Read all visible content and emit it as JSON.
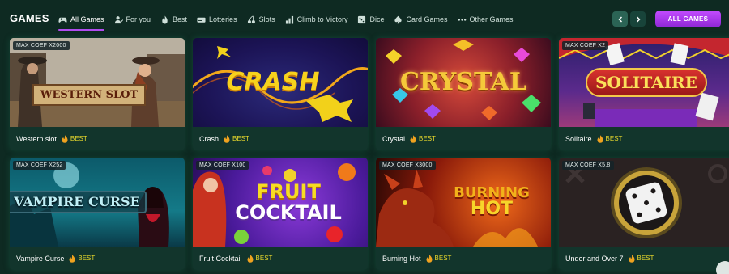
{
  "header": {
    "title": "GAMES",
    "all_games_label": "ALL GAMES",
    "prev_icon": "chevron-left-icon",
    "next_icon": "chevron-right-icon"
  },
  "tabs": [
    {
      "label": "All Games",
      "icon": "gamepad-icon",
      "active": true
    },
    {
      "label": "For you",
      "icon": "person-icon",
      "active": false
    },
    {
      "label": "Best",
      "icon": "flame-icon",
      "active": false
    },
    {
      "label": "Lotteries",
      "icon": "ticket-icon",
      "active": false
    },
    {
      "label": "Slots",
      "icon": "cherries-icon",
      "active": false
    },
    {
      "label": "Climb to Victory",
      "icon": "bar-chart-icon",
      "active": false
    },
    {
      "label": "Dice",
      "icon": "dice-icon",
      "active": false
    },
    {
      "label": "Card Games",
      "icon": "spade-icon",
      "active": false
    },
    {
      "label": "Other Games",
      "icon": "dots-icon",
      "active": false
    }
  ],
  "games": [
    {
      "name": "Western slot",
      "coef": "MAX COEF X2000",
      "best": "BEST",
      "logo": "WESTERN SLOT"
    },
    {
      "name": "Crash",
      "coef": "",
      "best": "BEST",
      "logo": "CRASH"
    },
    {
      "name": "Crystal",
      "coef": "",
      "best": "BEST",
      "logo": "CRYSTAL"
    },
    {
      "name": "Solitaire",
      "coef": "MAX COEF X2",
      "best": "BEST",
      "logo": "SOLITAIRE"
    },
    {
      "name": "Vampire Curse",
      "coef": "MAX COEF X252",
      "best": "BEST",
      "logo": "VAMPIRE CURSE"
    },
    {
      "name": "Fruit Cocktail",
      "coef": "MAX COEF X100",
      "best": "BEST",
      "logo_line1": "FRUIT",
      "logo_line2": "COCKTAIL"
    },
    {
      "name": "Burning Hot",
      "coef": "MAX COEF X3000",
      "best": "BEST",
      "logo_line1": "BURNING",
      "logo_line2": "HOT"
    },
    {
      "name": "Under and Over 7",
      "coef": "MAX COEF X5.8",
      "best": "BEST"
    }
  ],
  "colors": {
    "background": "#0e2a22",
    "accent_purple": "#b14cf0",
    "best_yellow": "#e6d72c"
  }
}
